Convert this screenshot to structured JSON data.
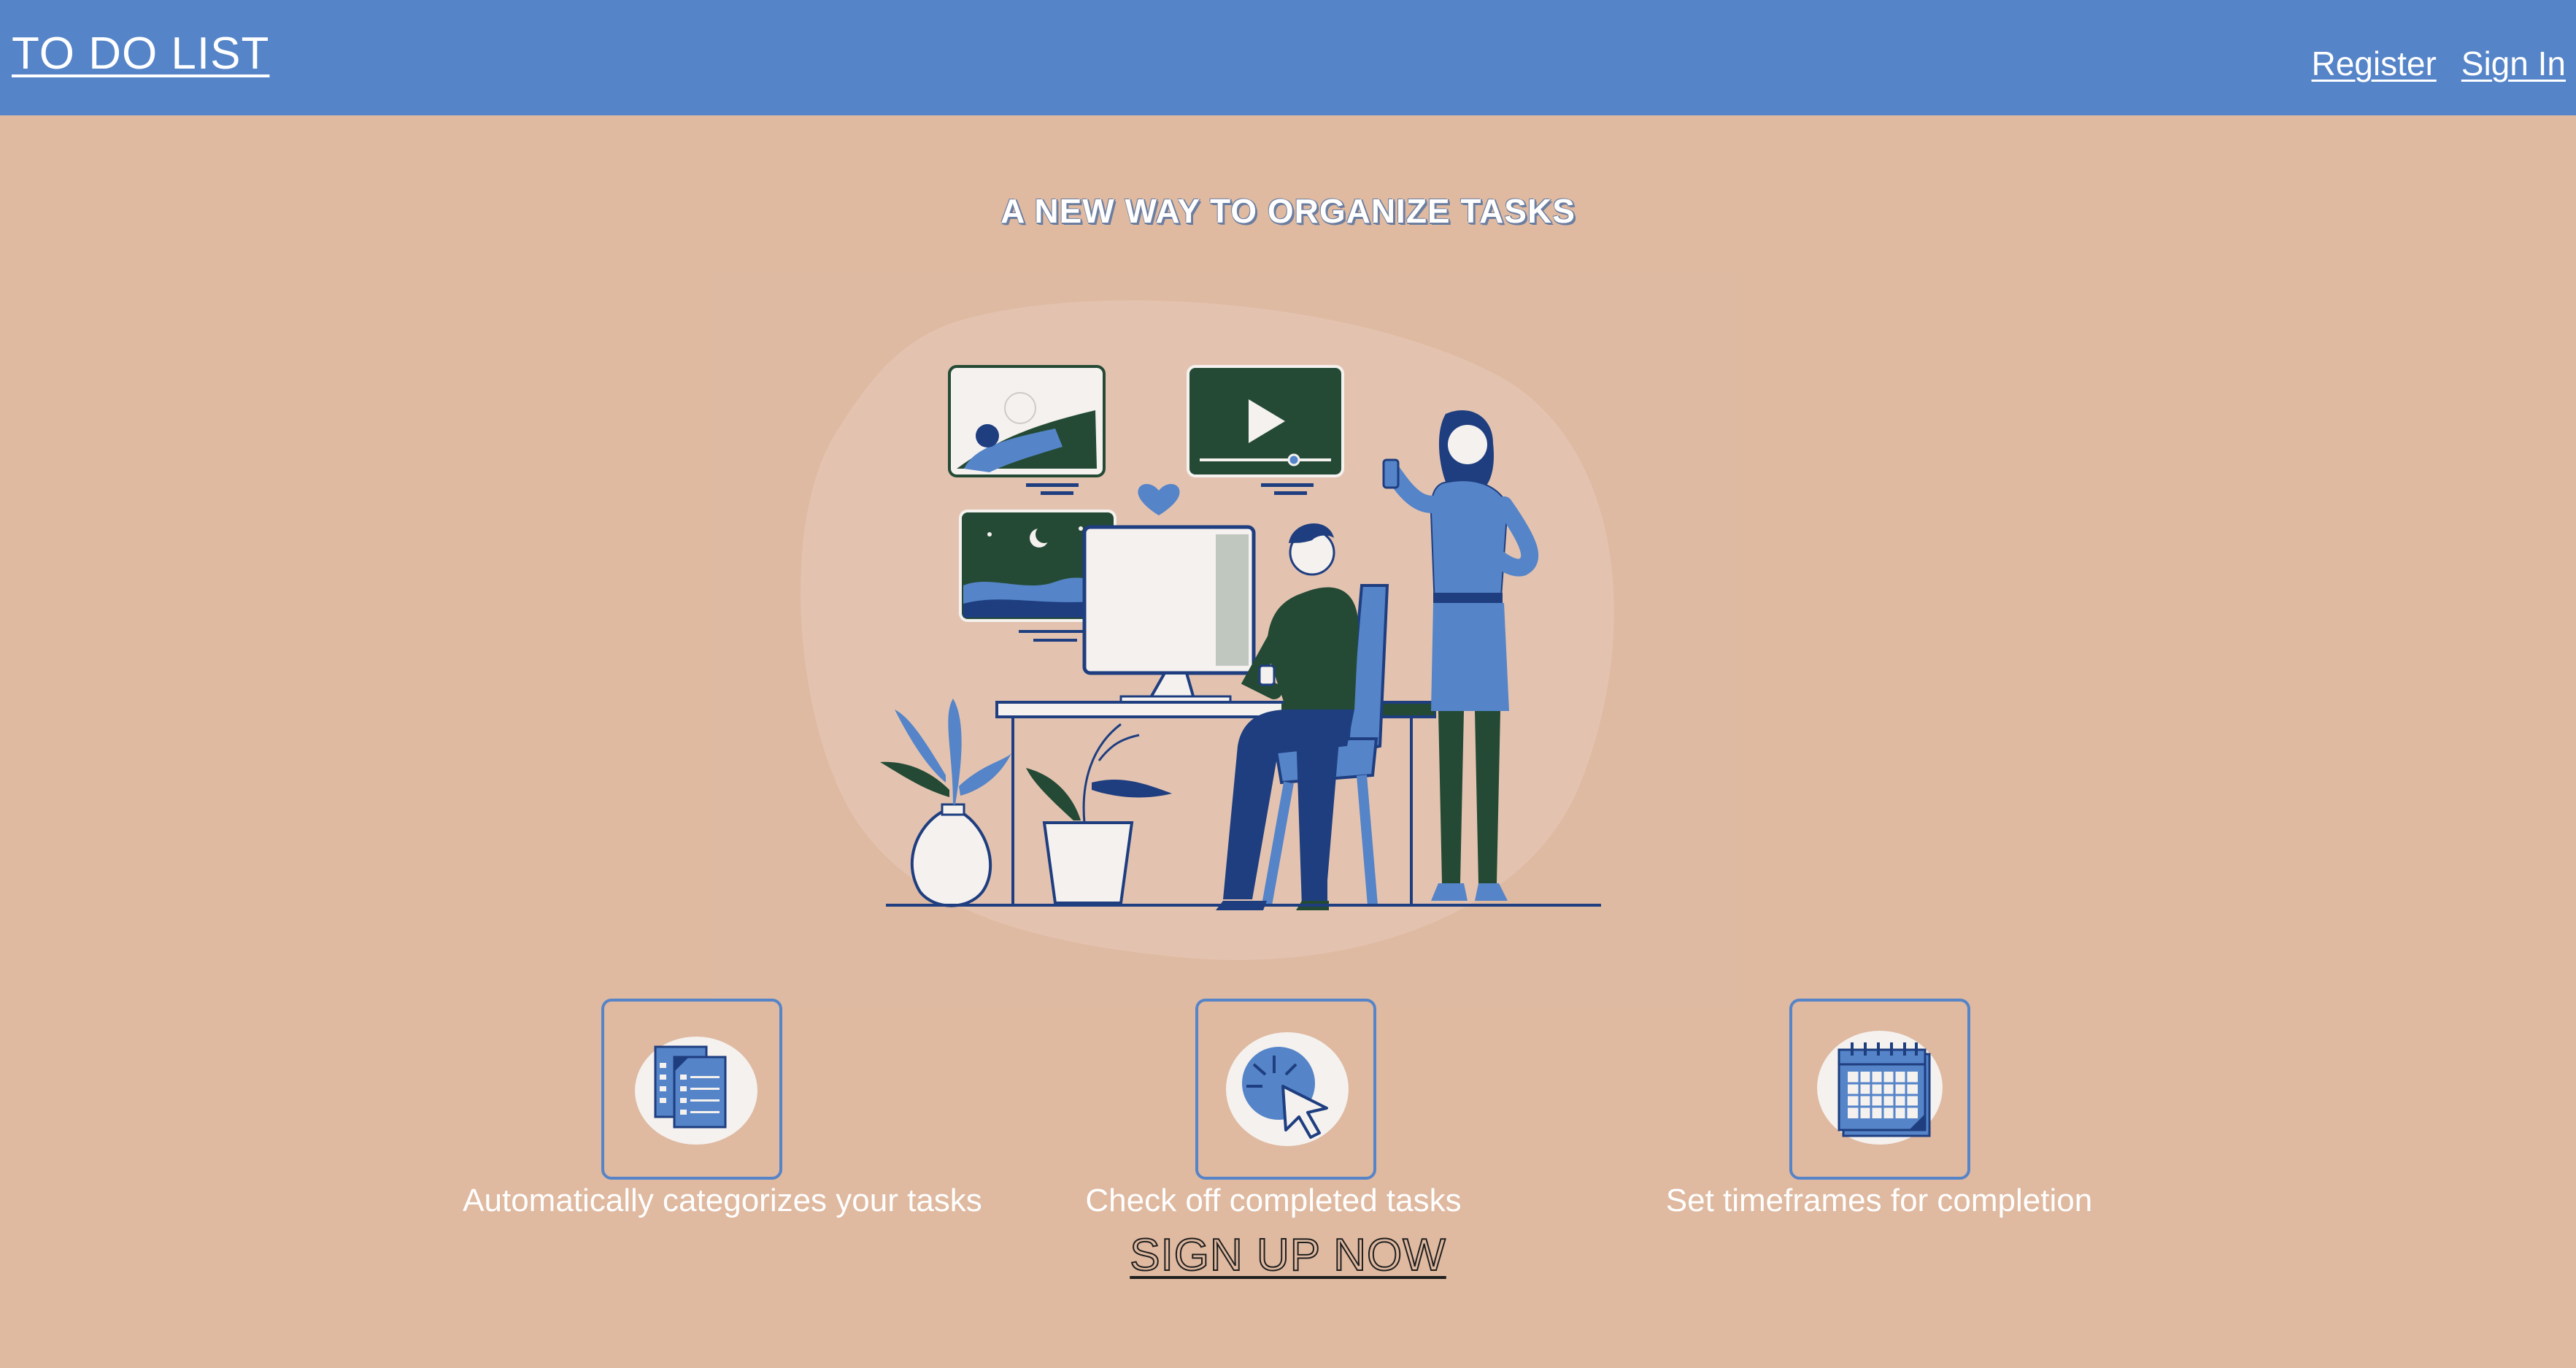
{
  "header": {
    "brand": "TO DO LIST",
    "links": [
      "Register",
      "Sign In"
    ]
  },
  "hero": {
    "headline": "A NEW WAY TO ORGANIZE TASKS",
    "illustration_icon": "person-at-desk-illustration"
  },
  "features": [
    {
      "icon": "documents-icon",
      "caption": "Automatically categorizes your tasks"
    },
    {
      "icon": "click-cursor-icon",
      "caption": "Check off completed tasks"
    },
    {
      "icon": "calendar-icon",
      "caption": "Set timeframes for completion"
    }
  ],
  "cta": {
    "label": "SIGN UP NOW"
  },
  "colors": {
    "navbar": "#5584c8",
    "background": "#dfb9a0",
    "text": "#ffffff",
    "accent_dark": "#244a35",
    "accent_blue": "#5584c8"
  }
}
